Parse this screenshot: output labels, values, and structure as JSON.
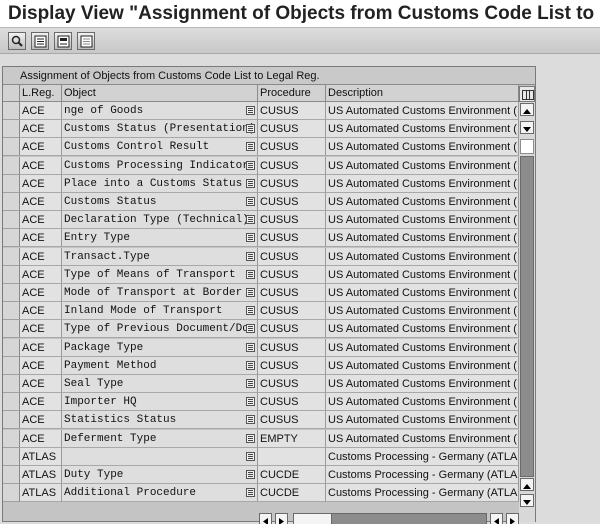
{
  "window": {
    "title": "Display View \"Assignment of Objects from Customs Code List to Legal"
  },
  "toolbar": {
    "buttons": [
      "details-icon",
      "select-all-icon",
      "select-block-icon",
      "deselect-all-icon"
    ]
  },
  "table": {
    "title": "Assignment of Objects from Customs Code List to Legal Reg.",
    "columns": [
      "L.Reg.",
      "Object",
      "Procedure",
      "Description"
    ],
    "rows": [
      {
        "lreg": "ACE",
        "object": "  nge of Goods",
        "proc": "CUSUS",
        "desc": "US Automated Customs Environment ("
      },
      {
        "lreg": "ACE",
        "object": "Customs Status (Presentation)",
        "proc": "CUSUS",
        "desc": "US Automated Customs Environment ("
      },
      {
        "lreg": "ACE",
        "object": "Customs Control Result",
        "proc": "CUSUS",
        "desc": "US Automated Customs Environment ("
      },
      {
        "lreg": "ACE",
        "object": "Customs Processing Indicator",
        "proc": "CUSUS",
        "desc": "US Automated Customs Environment ("
      },
      {
        "lreg": "ACE",
        "object": "Place into a Customs Status",
        "proc": "CUSUS",
        "desc": "US Automated Customs Environment ("
      },
      {
        "lreg": "ACE",
        "object": "Customs Status",
        "proc": "CUSUS",
        "desc": "US Automated Customs Environment ("
      },
      {
        "lreg": "ACE",
        "object": "Declaration Type (Technical)",
        "proc": "CUSUS",
        "desc": "US Automated Customs Environment ("
      },
      {
        "lreg": "ACE",
        "object": "Entry Type",
        "proc": "CUSUS",
        "desc": "US Automated Customs Environment ("
      },
      {
        "lreg": "ACE",
        "object": "Transact.Type",
        "proc": "CUSUS",
        "desc": "US Automated Customs Environment ("
      },
      {
        "lreg": "ACE",
        "object": "Type of Means of Transport",
        "proc": "CUSUS",
        "desc": "US Automated Customs Environment ("
      },
      {
        "lreg": "ACE",
        "object": "Mode of Transport at Border",
        "proc": "CUSUS",
        "desc": "US Automated Customs Environment ("
      },
      {
        "lreg": "ACE",
        "object": "Inland Mode of Transport",
        "proc": "CUSUS",
        "desc": "US Automated Customs Environment ("
      },
      {
        "lreg": "ACE",
        "object": "Type of Previous Document/Doc",
        "proc": "CUSUS",
        "desc": "US Automated Customs Environment ("
      },
      {
        "lreg": "ACE",
        "object": "Package Type",
        "proc": "CUSUS",
        "desc": "US Automated Customs Environment ("
      },
      {
        "lreg": "ACE",
        "object": "Payment Method",
        "proc": "CUSUS",
        "desc": "US Automated Customs Environment ("
      },
      {
        "lreg": "ACE",
        "object": "Seal Type",
        "proc": "CUSUS",
        "desc": "US Automated Customs Environment ("
      },
      {
        "lreg": "ACE",
        "object": "Importer HQ",
        "proc": "CUSUS",
        "desc": "US Automated Customs Environment ("
      },
      {
        "lreg": "ACE",
        "object": "Statistics Status",
        "proc": "CUSUS",
        "desc": "US Automated Customs Environment ("
      },
      {
        "lreg": "ACE",
        "object": "Deferment Type",
        "proc": "EMPTY",
        "desc": "US Automated Customs Environment ("
      },
      {
        "lreg": "ATLAS",
        "object": "",
        "proc": "",
        "desc": "Customs Processing - Germany (ATLA"
      },
      {
        "lreg": "ATLAS",
        "object": "Duty Type",
        "proc": "CUCDE",
        "desc": "Customs Processing - Germany (ATLA"
      },
      {
        "lreg": "ATLAS",
        "object": "Additional Procedure",
        "proc": "CUCDE",
        "desc": "Customs Processing - Germany (ATLA"
      }
    ]
  }
}
